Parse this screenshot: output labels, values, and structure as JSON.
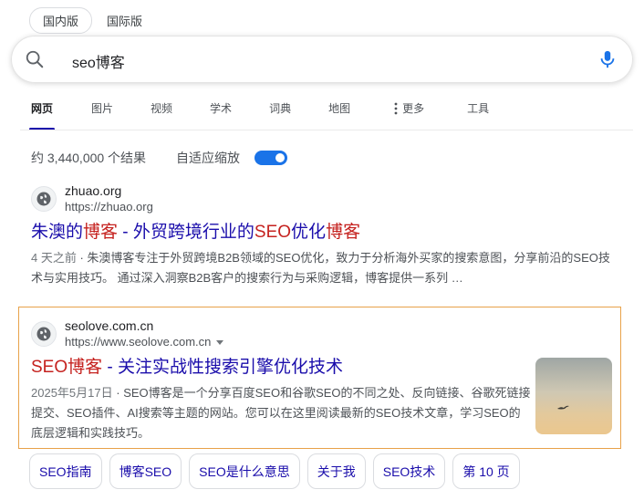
{
  "region": {
    "domestic": "国内版",
    "international": "国际版"
  },
  "search": {
    "query": "seo博客"
  },
  "tabs": [
    {
      "label": "网页",
      "active": true
    },
    {
      "label": "图片"
    },
    {
      "label": "视频"
    },
    {
      "label": "学术"
    },
    {
      "label": "词典"
    },
    {
      "label": "地图"
    },
    {
      "label": "更多"
    },
    {
      "label": "工具"
    }
  ],
  "stats": {
    "results": "约 3,440,000 个结果",
    "adaptive_label": "自适应缩放",
    "adaptive_on": true
  },
  "results": [
    {
      "site_name": "zhuao.org",
      "url": "https://zhuao.org",
      "title_parts": [
        "朱澳的",
        "博客",
        " - 外贸跨境行业的",
        "SEO",
        "优化",
        "博客"
      ],
      "date": "4 天之前",
      "snippet": "朱澳博客专注于外贸跨境B2B领域的SEO优化，致力于分析海外买家的搜索意图，分享前沿的SEO技术与实用技巧。 通过深入洞察B2B客户的搜索行为与采购逻辑，博客提供一系列 …"
    },
    {
      "site_name": "seolove.com.cn",
      "url": "https://www.seolove.com.cn",
      "title_parts": [
        "SEO博客",
        " - 关注实战性搜索引擎优化技术"
      ],
      "date": "2025年5月17日",
      "snippet": "SEO博客是一个分享百度SEO和谷歌SEO的不同之处、反向链接、谷歌死链接提交、SEO插件、AI搜索等主题的网站。您可以在这里阅读最新的SEO技术文章，学习SEO的底层逻辑和实践技巧。"
    }
  ],
  "chips": [
    "SEO指南",
    "博客SEO",
    "SEO是什么意思",
    "关于我",
    "SEO技术",
    "第 10 页"
  ],
  "colors": {
    "link": "#1a0dab",
    "highlight": "#c5221f",
    "toggle": "#1a73e8",
    "featured_border": "#e8a24a"
  }
}
